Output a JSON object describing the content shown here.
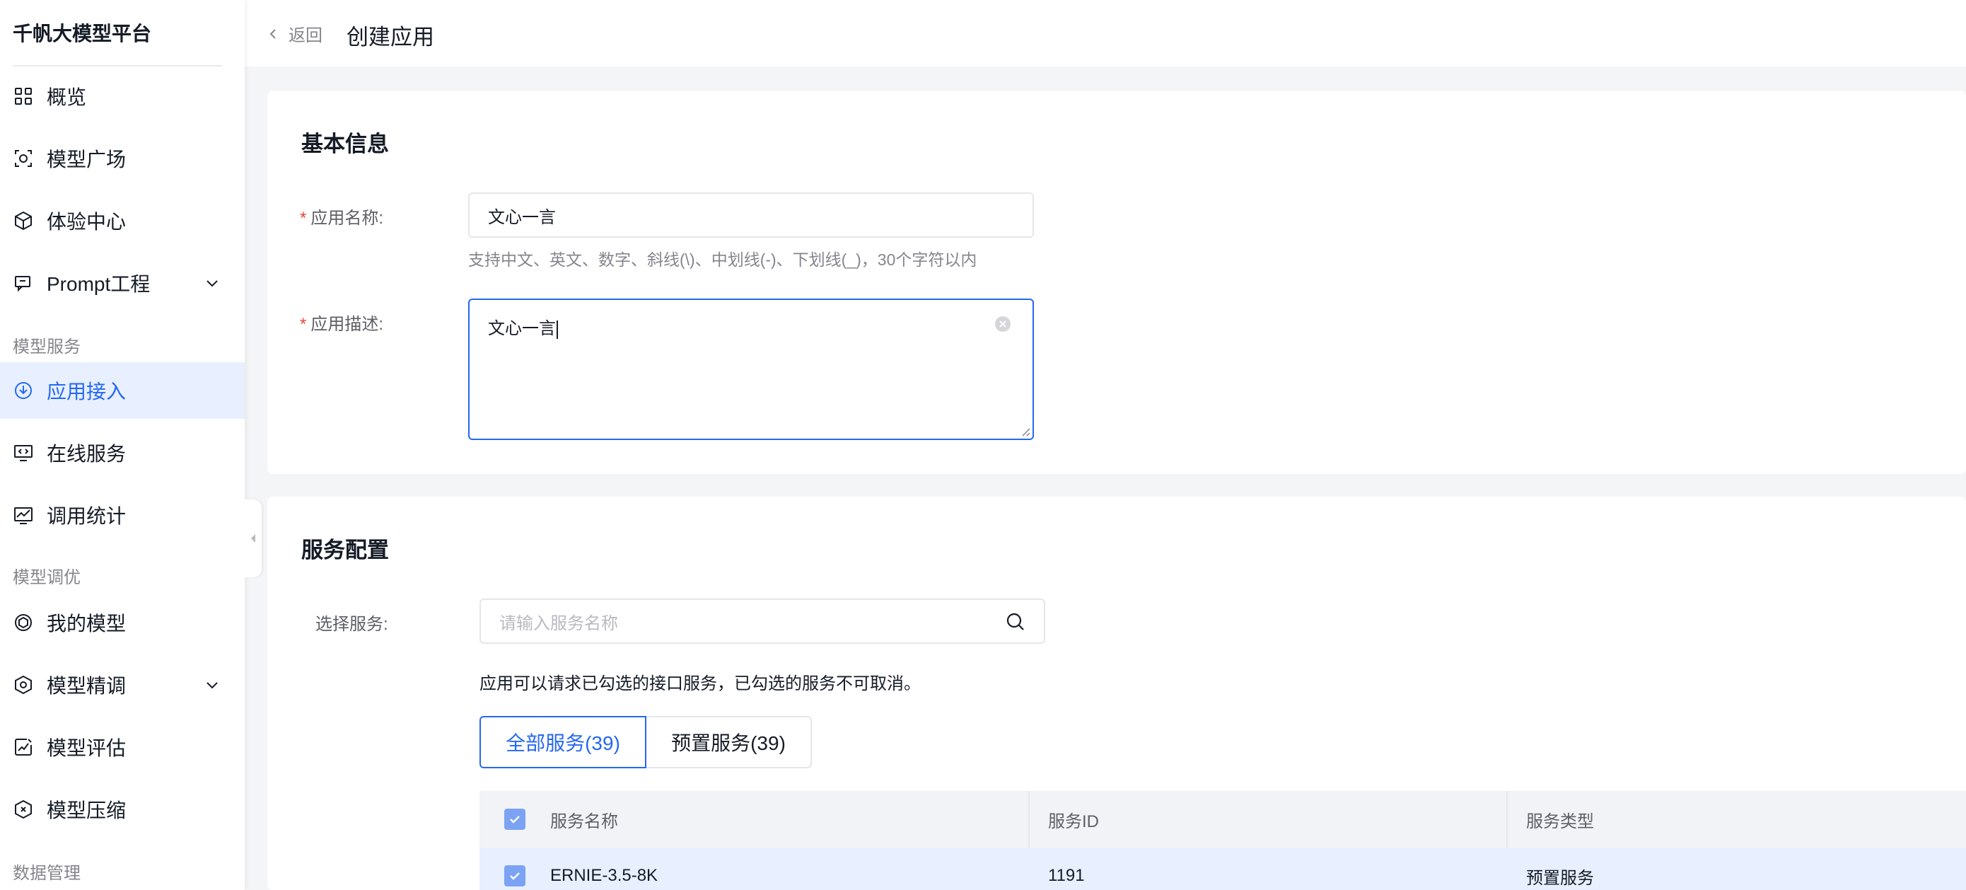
{
  "sidebar": {
    "brand": "千帆大模型平台",
    "items": [
      {
        "label": "概览",
        "icon": "grid-icon"
      },
      {
        "label": "模型广场",
        "icon": "scan-model-icon"
      },
      {
        "label": "体验中心",
        "icon": "cube-icon"
      },
      {
        "label": "Prompt工程",
        "icon": "prompt-icon",
        "expandable": true
      }
    ],
    "group_model_service": "模型服务",
    "service_items": [
      {
        "label": "应用接入",
        "icon": "app-access-icon",
        "active": true
      },
      {
        "label": "在线服务",
        "icon": "online-service-icon"
      },
      {
        "label": "调用统计",
        "icon": "stats-icon"
      }
    ],
    "group_model_tuning": "模型调优",
    "tuning_items": [
      {
        "label": "我的模型",
        "icon": "my-model-icon"
      },
      {
        "label": "模型精调",
        "icon": "fine-tune-icon",
        "expandable": true
      },
      {
        "label": "模型评估",
        "icon": "evaluate-icon"
      },
      {
        "label": "模型压缩",
        "icon": "compress-icon"
      }
    ],
    "group_data": "数据管理"
  },
  "header": {
    "back_label": "返回",
    "title": "创建应用"
  },
  "basic_info": {
    "title": "基本信息",
    "name_label": "应用名称:",
    "name_value": "文心一言",
    "name_hint": "支持中文、英文、数字、斜线(\\)、中划线(-)、下划线(_)，30个字符以内",
    "desc_label": "应用描述:",
    "desc_value": "文心一言"
  },
  "service_config": {
    "title": "服务配置",
    "select_label": "选择服务:",
    "search_placeholder": "请输入服务名称",
    "note": "应用可以请求已勾选的接口服务，已勾选的服务不可取消。",
    "tabs": [
      {
        "label": "全部服务(39)",
        "active": true
      },
      {
        "label": "预置服务(39)",
        "active": false
      }
    ],
    "table": {
      "columns": [
        "服务名称",
        "服务ID",
        "服务类型"
      ],
      "rows": [
        {
          "name": "ERNIE-3.5-8K",
          "id": "1191",
          "type": "预置服务",
          "checked": true
        }
      ]
    }
  },
  "colors": {
    "accent": "#2468f2",
    "required": "#e8473b",
    "active_bg": "#e8f0ff",
    "checkbox": "#7ca3f3"
  }
}
